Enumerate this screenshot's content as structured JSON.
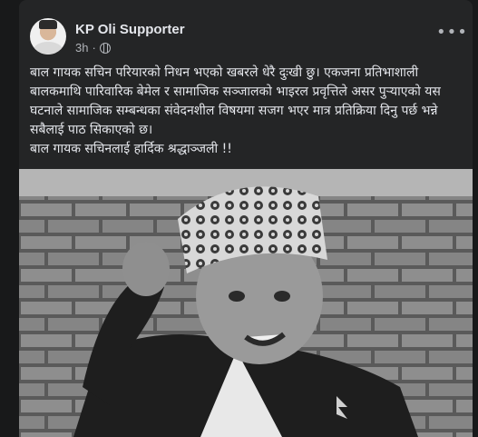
{
  "post": {
    "author": "KP Oli Supporter",
    "time": "3h",
    "privacy_icon": "globe-icon",
    "more_icon": "ellipsis-icon",
    "more_label": "•••",
    "paragraphs": [
      "बाल गायक सचिन परियारको निधन भएको खबरले धेरै दुःखी छु। एकजना प्रतिभाशाली बालकमाथि पारिवारिक बेमेल र सामाजिक सञ्जालको भाइरल प्रवृत्तिले असर पुर्‍याएको यस घटनाले सामाजिक सम्बन्धका संवेदनशील विषयमा सजग भएर मात्र प्रतिक्रिया दिनु पर्छ भन्ने सबैलाई पाठ सिकाएको छ।",
      "बाल गायक सचिनलाई हार्दिक श्रद्धाञ्जली !!"
    ],
    "photo": {
      "description_icon": "post-photo",
      "colors": {
        "background": "#242526",
        "text": "#e4e6eb",
        "muted": "#b0b3b8"
      }
    }
  }
}
